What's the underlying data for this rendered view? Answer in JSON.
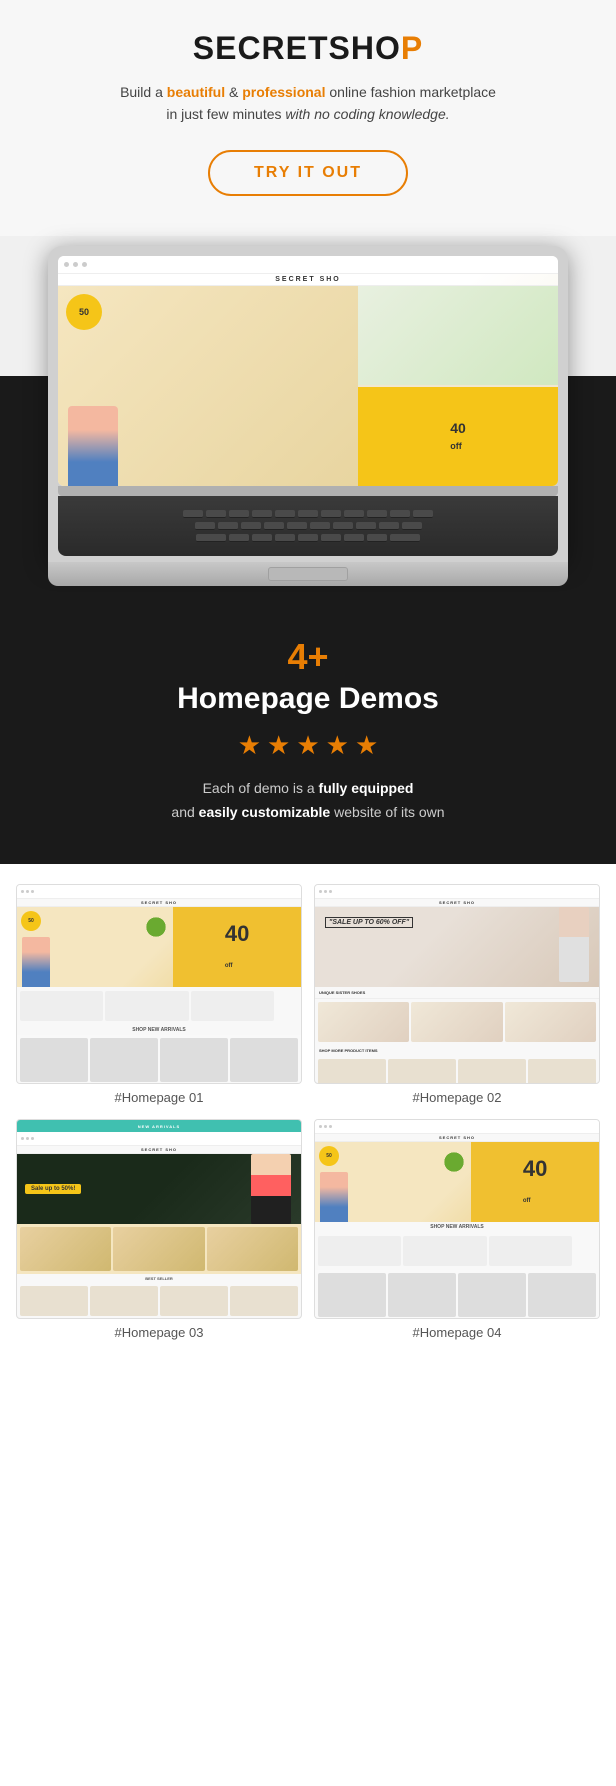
{
  "header": {
    "logo_prefix": "SECRETSHO",
    "logo_accent": "P",
    "tagline_normal1": "Build a ",
    "tagline_beautiful": "beautiful",
    "tagline_normal2": " & ",
    "tagline_professional": "professional",
    "tagline_normal3": " online fashion marketplace",
    "tagline_line2_normal": "in just few minutes ",
    "tagline_italic": "with no coding knowledge."
  },
  "cta": {
    "button_label": "TRY IT OUT"
  },
  "stats": {
    "count": "4+",
    "title": "Homepage Demos",
    "stars_count": 5,
    "description_normal1": "Each of demo is a ",
    "description_bold1": "fully equipped",
    "description_normal2": "\nand ",
    "description_bold2": "easily customizable",
    "description_normal3": " website of its own"
  },
  "demos": [
    {
      "id": "01",
      "label": "#Homepage 01"
    },
    {
      "id": "02",
      "label": "#Homepage 02"
    },
    {
      "id": "03",
      "label": "#Homepage 03"
    },
    {
      "id": "04",
      "label": "#Homepage 04"
    }
  ],
  "colors": {
    "accent": "#e87e04",
    "dark_bg": "#1a1a1a",
    "star": "#e87e04"
  }
}
